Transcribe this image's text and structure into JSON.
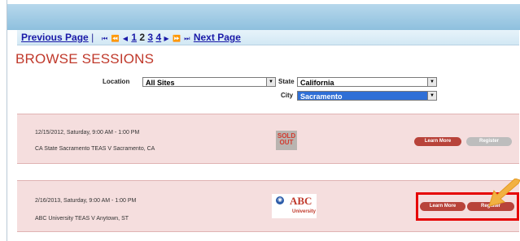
{
  "pagination": {
    "previous": "Previous Page",
    "separator": "|",
    "controls": "⏮ ⏪ ◀",
    "pages": [
      "1",
      "2",
      "3",
      "4"
    ],
    "current": "2",
    "controls_after": "▶ ⏩ ⏭",
    "next": "Next Page"
  },
  "page": {
    "title": "BROWSE SESSIONS"
  },
  "filters": {
    "location_label": "Location",
    "location_value": "All Sites",
    "state_label": "State",
    "state_value": "California",
    "city_label": "City",
    "city_value": "Sacramento"
  },
  "sessions": [
    {
      "datetime": "12/15/2012, Saturday, 9:00 AM - 1:00 PM",
      "place": "CA State Sacramento TEAS V Sacramento, CA",
      "status_badge": "SOLD OUT",
      "learn_more": "Learn More",
      "register": "Register"
    },
    {
      "datetime": "2/16/2013, Saturday, 9:00 AM - 1:00 PM",
      "place": "ABC University TEAS V Anytown, ST",
      "logo_top": "ABC",
      "logo_bottom": "University",
      "learn_more": "Learn More",
      "register": "Register"
    }
  ],
  "colors": {
    "accent": "#c0392b",
    "row_bg": "#f5dede",
    "highlight": "#e60000",
    "pointer": "#f2b142",
    "header": "#9fcbe5"
  },
  "icons": {
    "pagination_first": "first-page-icon",
    "pagination_prev": "previous-icon",
    "pagination_next": "next-icon",
    "pagination_last": "last-page-icon",
    "dropdown": "chevron-down-icon",
    "pointer": "arrow-pointer-icon"
  }
}
